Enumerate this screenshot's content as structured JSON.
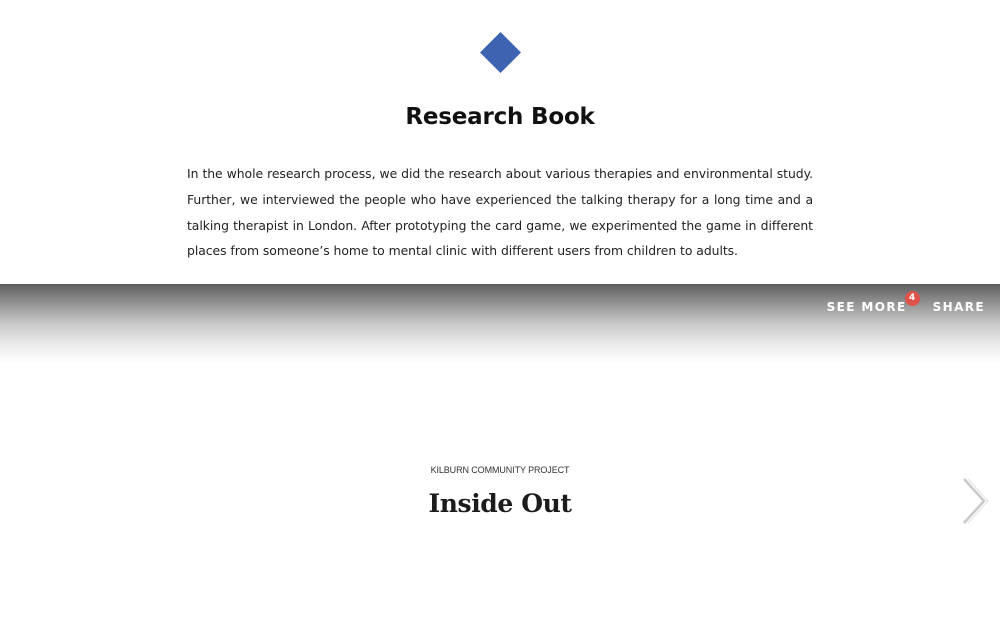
{
  "article": {
    "icon": "diamond-icon",
    "accent_color": "#3e63b0",
    "title": "Research Book",
    "body": "In the whole research process, we did the research about various therapies and environmental study. Further, we interviewed the people who have experienced the talking therapy for a long time and a talking therapist in London. After prototyping the card game, we experimented the game in different places from someone’s home to mental clinic with different users from children to adults."
  },
  "actions": {
    "see_more_label": "SEE MORE",
    "see_more_count": "4",
    "share_label": "SHARE",
    "badge_color": "#e0524a"
  },
  "next_project": {
    "kicker": "KILBURN COMMUNITY PROJECT",
    "title": "Inside Out",
    "title_dot_color": "#e8b84a",
    "arrow_icon": "chevron-right-icon"
  }
}
